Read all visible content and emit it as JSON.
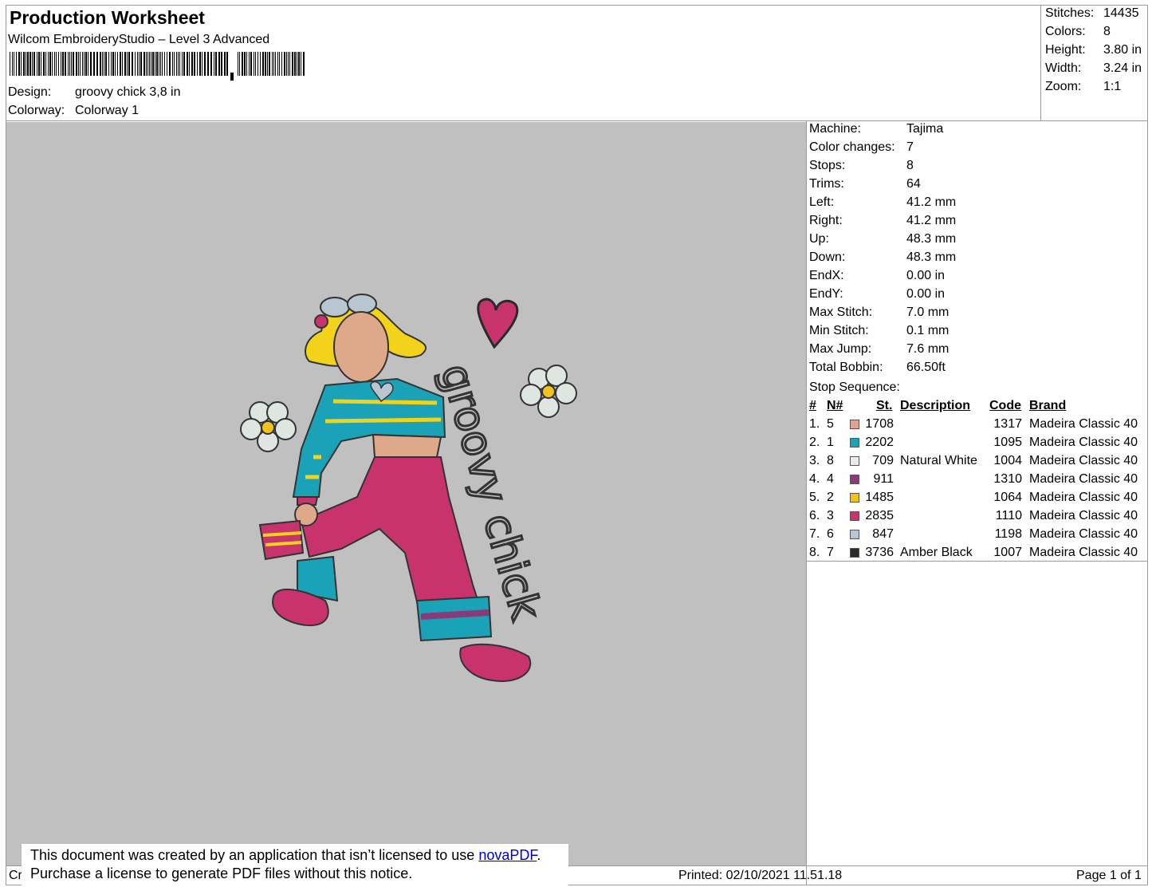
{
  "header": {
    "title": "Production Worksheet",
    "software": "Wilcom EmbroideryStudio – Level 3 Advanced",
    "design_label": "Design:",
    "design_value": "groovy chick 3,8 in",
    "colorway_label": "Colorway:",
    "colorway_value": "Colorway 1"
  },
  "summary": [
    {
      "label": "Stitches:",
      "value": "14435"
    },
    {
      "label": "Colors:",
      "value": "8"
    },
    {
      "label": "Height:",
      "value": "3.80 in"
    },
    {
      "label": "Width:",
      "value": "3.24 in"
    },
    {
      "label": "Zoom:",
      "value": "1:1"
    }
  ],
  "design_text": "groovy chick",
  "machine_info": [
    {
      "label": "Machine:",
      "value": "Tajima"
    },
    {
      "label": "Color changes:",
      "value": "7"
    },
    {
      "label": "Stops:",
      "value": "8"
    },
    {
      "label": "Trims:",
      "value": "64"
    },
    {
      "label": "Left:",
      "value": "41.2 mm"
    },
    {
      "label": "Right:",
      "value": "41.2 mm"
    },
    {
      "label": "Up:",
      "value": "48.3 mm"
    },
    {
      "label": "Down:",
      "value": "48.3 mm"
    },
    {
      "label": "EndX:",
      "value": "0.00 in"
    },
    {
      "label": "EndY:",
      "value": "0.00 in"
    },
    {
      "label": "Max Stitch:",
      "value": "7.0 mm"
    },
    {
      "label": "Min Stitch:",
      "value": "0.1 mm"
    },
    {
      "label": "Max Jump:",
      "value": "7.6 mm"
    },
    {
      "label": "Total Bobbin:",
      "value": "66.50ft"
    }
  ],
  "stop_sequence": {
    "title": "Stop Sequence:",
    "headers": {
      "num": "#",
      "n": "N#",
      "st": "St.",
      "description": "Description",
      "code": "Code",
      "brand": "Brand"
    },
    "rows": [
      {
        "num": "1.",
        "n": "5",
        "color": "#e8a090",
        "st": "1708",
        "description": "",
        "code": "1317",
        "brand": "Madeira Classic 40"
      },
      {
        "num": "2.",
        "n": "1",
        "color": "#1aa3b8",
        "st": "2202",
        "description": "",
        "code": "1095",
        "brand": "Madeira Classic 40"
      },
      {
        "num": "3.",
        "n": "8",
        "color": "#ebebeb",
        "st": "709",
        "description": "Natural White",
        "code": "1004",
        "brand": "Madeira Classic 40"
      },
      {
        "num": "4.",
        "n": "4",
        "color": "#8a3a78",
        "st": "911",
        "description": "",
        "code": "1310",
        "brand": "Madeira Classic 40"
      },
      {
        "num": "5.",
        "n": "2",
        "color": "#f2c21a",
        "st": "1485",
        "description": "",
        "code": "1064",
        "brand": "Madeira Classic 40"
      },
      {
        "num": "6.",
        "n": "3",
        "color": "#c8336e",
        "st": "2835",
        "description": "",
        "code": "1110",
        "brand": "Madeira Classic 40"
      },
      {
        "num": "7.",
        "n": "6",
        "color": "#b7c6d0",
        "st": "847",
        "description": "",
        "code": "1198",
        "brand": "Madeira Classic 40"
      },
      {
        "num": "8.",
        "n": "7",
        "color": "#2a2a2a",
        "st": "3736",
        "description": "Amber Black",
        "code": "1007",
        "brand": "Madeira Classic 40"
      }
    ]
  },
  "footer": {
    "left_fragment": "Cr",
    "printed": "Printed: 02/10/2021 11.51.18",
    "page": "Page 1 of 1"
  },
  "notice": {
    "line1_prefix": "This document was created by an application that isn’t licensed to use ",
    "link": "novaPDF",
    "line1_suffix": ".",
    "line2": "Purchase a license to generate PDF files without this notice."
  }
}
